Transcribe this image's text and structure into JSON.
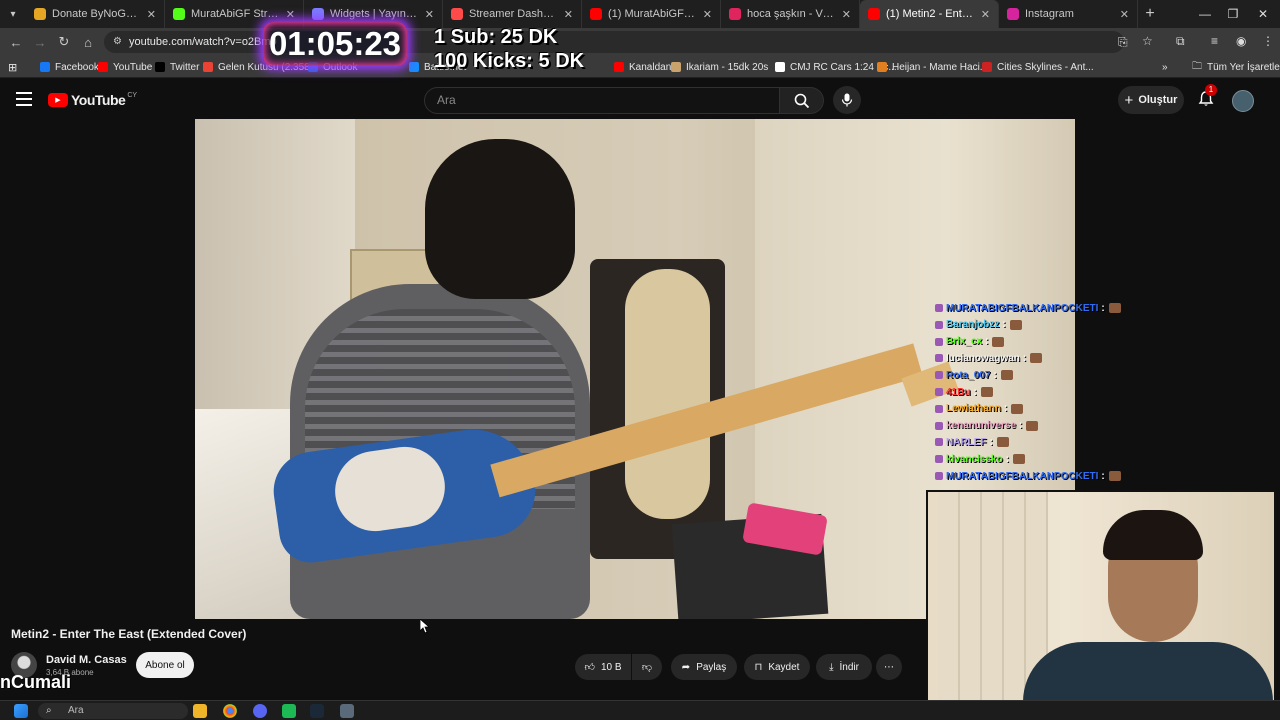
{
  "browser": {
    "tabs": [
      {
        "label": "Donate ByNoGame | Donate",
        "color": "#e5a623"
      },
      {
        "label": "MuratAbiGF Stream - Widgets",
        "color": "#53fc18"
      },
      {
        "label": "Widgets | Yayınını güçlendir",
        "color": "#7b7bff"
      },
      {
        "label": "Streamer Dashboard",
        "color": "#ff4a4a"
      },
      {
        "label": "(1) MuratAbiGF - Cities Skylines",
        "color": "#ff0000"
      },
      {
        "label": "hoca şaşkın - Video Alert",
        "color": "#e0245e"
      },
      {
        "label": "(1) Metin2 - Enter The East",
        "color": "#ff0000"
      },
      {
        "label": "Instagram",
        "color": "#d6249f"
      }
    ],
    "url": "youtube.com/watch?v=o2Bm0",
    "bookmarks": [
      {
        "label": "Facebook",
        "color": "#1877f2"
      },
      {
        "label": "YouTube",
        "color": "#ff0000"
      },
      {
        "label": "Twitter",
        "color": "#000000"
      },
      {
        "label": "Gelen Kutusu (2.358)",
        "color": "#ea4335"
      },
      {
        "label": "Outlook",
        "color": "#0078d4"
      },
      {
        "label": "Battle.net",
        "color": "#148eff"
      },
      {
        "label": "Kanaldan",
        "color": "#ff0000"
      },
      {
        "label": "Ikariam - 15dk 20s",
        "color": "#c9a36b"
      },
      {
        "label": "CMJ RC Cars 1:24 Sc...",
        "color": "#ffffff"
      },
      {
        "label": "Heijan - Mame Haci...",
        "color": "#e08020"
      },
      {
        "label": "Cities Skylines - Ant...",
        "color": "#cc2222"
      }
    ],
    "bookmarks_all": "Tüm Yer İşaretleri"
  },
  "youtube": {
    "logo_text": "YouTube",
    "logo_country": "CY",
    "search_placeholder": "Ara",
    "create_label": "Oluştur",
    "notif_count": "1",
    "video_title": "Metin2 - Enter The East (Extended Cover)",
    "channel_name": "David M. Casas",
    "subscribers": "3,64 B abone",
    "subscribe_label": "Abone ol",
    "like_count": "10 B",
    "share_label": "Paylaş",
    "save_label": "Kaydet",
    "download_label": "İndir"
  },
  "overlay": {
    "timer": "01:05:23",
    "goal_1": "1 Sub: 25 DK",
    "goal_2": "100 Kicks: 5 DK",
    "ghost_name": "nCumali"
  },
  "chat": [
    {
      "user": "MURATABIGFBALKANPOCKETI",
      "color": "#2f6cf7"
    },
    {
      "user": "Baranjobzz",
      "color": "#4fc8ef"
    },
    {
      "user": "Brix_cx",
      "color": "#53fc18"
    },
    {
      "user": "lucianowagwan",
      "color": "#f1f1f1"
    },
    {
      "user": "Rota_007",
      "color": "#2f6cf7"
    },
    {
      "user": "41Bu",
      "color": "#ff3333"
    },
    {
      "user": "Lewiathann",
      "color": "#f5a623"
    },
    {
      "user": "kenanuniverse",
      "color": "#f5a3c8"
    },
    {
      "user": "NARLEF",
      "color": "#b9a3f5"
    },
    {
      "user": "kivancissko",
      "color": "#53fc18"
    },
    {
      "user": "MURATABIGFBALKANPOCKETI",
      "color": "#2f6cf7"
    }
  ],
  "taskbar": {
    "search_placeholder": "Ara"
  }
}
